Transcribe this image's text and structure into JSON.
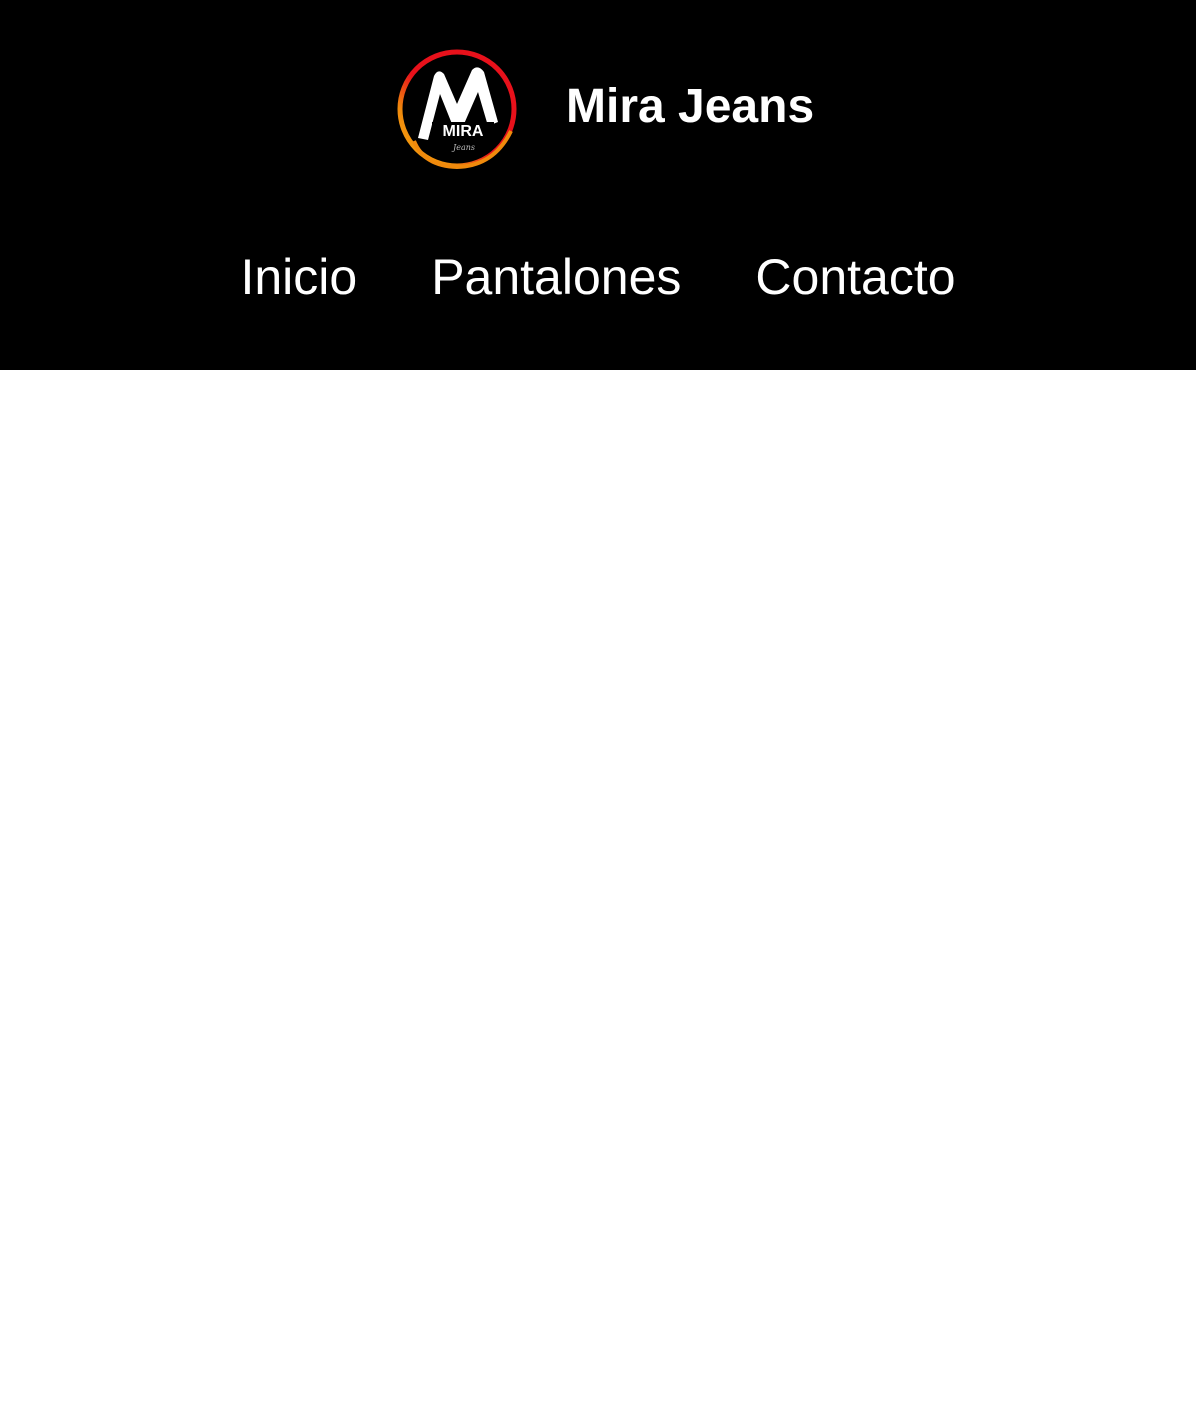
{
  "brand": {
    "name": "Mira Jeans",
    "logo_text": "MIRA",
    "logo_script": "Jeans",
    "logo_icon": "mira-jeans-logo"
  },
  "nav": {
    "items": [
      {
        "label": "Inicio"
      },
      {
        "label": "Pantalones"
      },
      {
        "label": "Contacto"
      }
    ]
  },
  "colors": {
    "header_bg": "#000000",
    "page_bg": "#ffffff",
    "text": "#ffffff",
    "logo_ring_red": "#e8111b",
    "logo_ring_orange": "#f08a0c"
  }
}
